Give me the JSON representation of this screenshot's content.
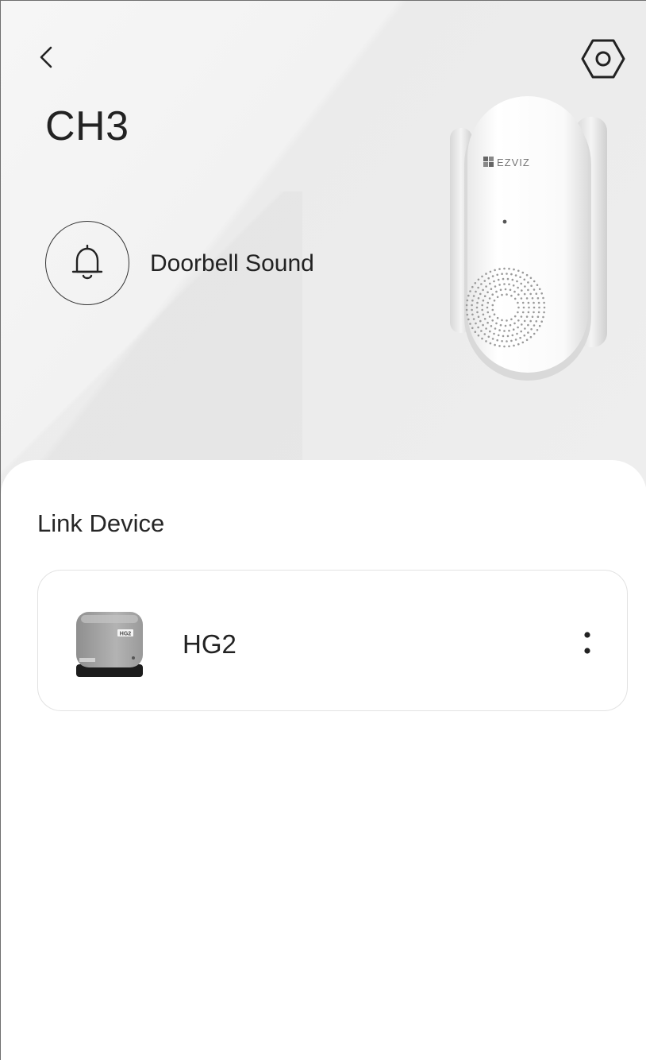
{
  "header": {
    "back_icon": "chevron-left-icon",
    "settings_icon": "hex-gear-icon",
    "title": "CH3"
  },
  "doorbell": {
    "icon": "bell-icon",
    "label": "Doorbell Sound"
  },
  "device_image": {
    "brand": "EZVIZ"
  },
  "link_device": {
    "section_title": "Link Device",
    "devices": [
      {
        "name": "HG2",
        "thumb_label": "HG2",
        "menu_icon": "more-vertical-icon"
      }
    ]
  }
}
